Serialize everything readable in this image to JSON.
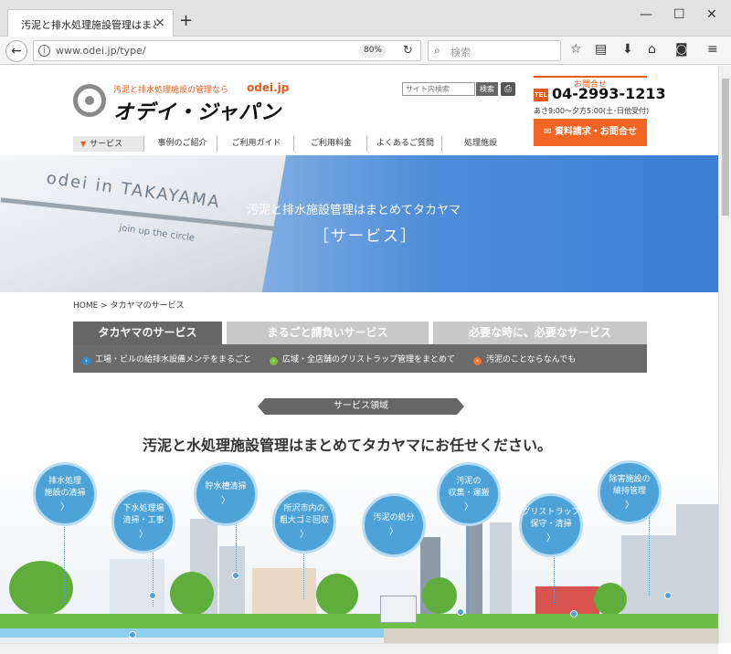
{
  "browser": {
    "tab_title": "汚泥と排水処理施設管理はまとめてタカ",
    "url": "www.odei.jp/type/",
    "zoom": "80%",
    "search_placeholder": "検索"
  },
  "header": {
    "tagline": "汚泥と排水処理施設の管理なら",
    "domain": "odei.jp",
    "brand": "オデイ・ジャパン",
    "site_search_placeholder": "サイト内検索",
    "site_search_button": "検索",
    "contact_label": "お問合せ",
    "tel_badge": "TEL",
    "tel": "04-2993-1213",
    "hours": "あさ9:00〜夕方5:00(土･日他受付)",
    "cta": "資料請求・お問合せ"
  },
  "gnav": [
    {
      "label": "サービス",
      "active": true
    },
    {
      "label": "事例のご紹介"
    },
    {
      "label": "ご利用ガイド"
    },
    {
      "label": "ご利用料金"
    },
    {
      "label": "よくあるご質問"
    },
    {
      "label": "処理施設"
    }
  ],
  "hero": {
    "subtitle": "汚泥と排水施設管理はまとめてタカヤマ",
    "title": "［サービス］",
    "truck_text": "odei in TAKAYAMA",
    "truck_text2": "join up the circle"
  },
  "breadcrumb": "HOME > タカヤマのサービス",
  "service_tabs": [
    {
      "label": "タカヤマのサービス",
      "active": true
    },
    {
      "label": "まるごと請負いサービス"
    },
    {
      "label": "必要な時に、必要なサービス"
    }
  ],
  "sub_links": [
    {
      "label": "工場・ビルの給排水設備メンテをまるごと",
      "color": "#2e8fd0"
    },
    {
      "label": "広域・全店舗のグリストラップ管理をまとめて",
      "color": "#7cbf3b"
    },
    {
      "label": "汚泥のことならなんでも",
      "color": "#f0782a"
    }
  ],
  "section_label": "サービス領域",
  "main_heading": "汚泥と水処理施設管理はまとめてタカヤマにお任せください。",
  "bubbles": [
    {
      "line1": "排水処理",
      "line2": "施設の清掃"
    },
    {
      "line1": "下水処理場",
      "line2": "清掃・工事"
    },
    {
      "line1": "貯水槽清掃",
      "line2": ""
    },
    {
      "line1": "所沢市内の",
      "line2": "粗大ゴミ回収"
    },
    {
      "line1": "汚泥の処分",
      "line2": ""
    },
    {
      "line1": "汚泥の",
      "line2": "収集・運搬"
    },
    {
      "line1": "グリストラップ",
      "line2": "保守・清掃"
    },
    {
      "line1": "除害施設の",
      "line2": "維持管理"
    }
  ],
  "bubble_arrow": "〉"
}
